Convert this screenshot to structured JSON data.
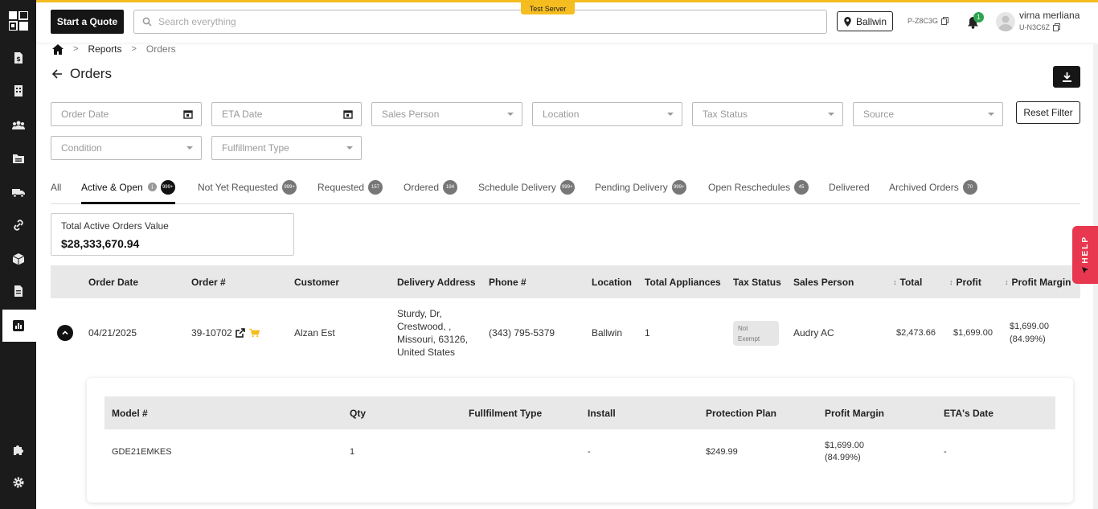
{
  "header": {
    "quote_button": "Start a Quote",
    "search_placeholder": "Search everything",
    "test_server": "Test Server",
    "location": "Ballwin",
    "p_code": "P-Z8C3G",
    "notification_count": "1",
    "user_name": "virna merliana",
    "u_code": "U-N3C6Z"
  },
  "breadcrumb": {
    "home": "home",
    "reports": "Reports",
    "current": "Orders"
  },
  "page_title": "Orders",
  "filters": {
    "order_date": "Order Date",
    "eta_date": "ETA Date",
    "sales_person": "Sales Person",
    "location": "Location",
    "tax_status": "Tax Status",
    "source": "Source",
    "condition": "Condition",
    "fulfillment_type": "Fulfillment Type",
    "reset": "Reset Filter"
  },
  "tabs": [
    {
      "label": "All",
      "count": ""
    },
    {
      "label": "Active & Open",
      "count": "999+"
    },
    {
      "label": "Not Yet Requested",
      "count": "999+"
    },
    {
      "label": "Requested",
      "count": "157"
    },
    {
      "label": "Ordered",
      "count": "194"
    },
    {
      "label": "Schedule Delivery",
      "count": "999+"
    },
    {
      "label": "Pending Delivery",
      "count": "999+"
    },
    {
      "label": "Open Reschedules",
      "count": "45"
    },
    {
      "label": "Delivered",
      "count": ""
    },
    {
      "label": "Archived Orders",
      "count": "70"
    }
  ],
  "summary": {
    "label": "Total Active Orders Value",
    "value": "$28,333,670.94"
  },
  "table": {
    "headers": [
      "Order Date",
      "Order #",
      "Customer",
      "Delivery Address",
      "Phone #",
      "Location",
      "Total Appliances",
      "Tax Status",
      "Sales Person",
      "Total",
      "Profit",
      "Profit Margin"
    ],
    "row": {
      "order_date": "04/21/2025",
      "order_no": "39-10702",
      "customer": "Alzan Est",
      "address_1": "Sturdy, Dr,",
      "address_2": "Crestwood, ,",
      "address_3": "Missouri, 63126,",
      "address_4": "United States",
      "phone": "(343) 795-5379",
      "location": "Ballwin",
      "appliances": "1",
      "tax_status_1": "Not",
      "tax_status_2": "Exempt",
      "sales_person": "Audry AC",
      "total": "$2,473.66",
      "profit": "$1,699.00",
      "margin_1": "$1,699.00",
      "margin_2": "(84.99%)"
    }
  },
  "sub_table": {
    "headers": [
      "Model #",
      "Qty",
      "Fullfilment Type",
      "Install",
      "Protection Plan",
      "Profit Margin",
      "ETA's Date"
    ],
    "row": {
      "model": "GDE21EMKES",
      "qty": "1",
      "fulfillment": "",
      "install": "-",
      "protection": "$249.99",
      "margin_1": "$1,699.00",
      "margin_2": "(84.99%)",
      "eta": "-"
    }
  },
  "help": "HELP",
  "icons": {
    "sidebar": [
      "dollar-doc-icon",
      "building-icon",
      "users-icon",
      "folder-icon",
      "truck-icon",
      "link-icon",
      "box-icon",
      "document-icon",
      "report-chart-icon",
      "puzzle-icon",
      "gear-icon"
    ]
  },
  "colors": {
    "accent": "#f5bd1f",
    "sidebar": "#1b1b1b",
    "help": "#e8384f",
    "badge_green": "#2ea44f"
  }
}
